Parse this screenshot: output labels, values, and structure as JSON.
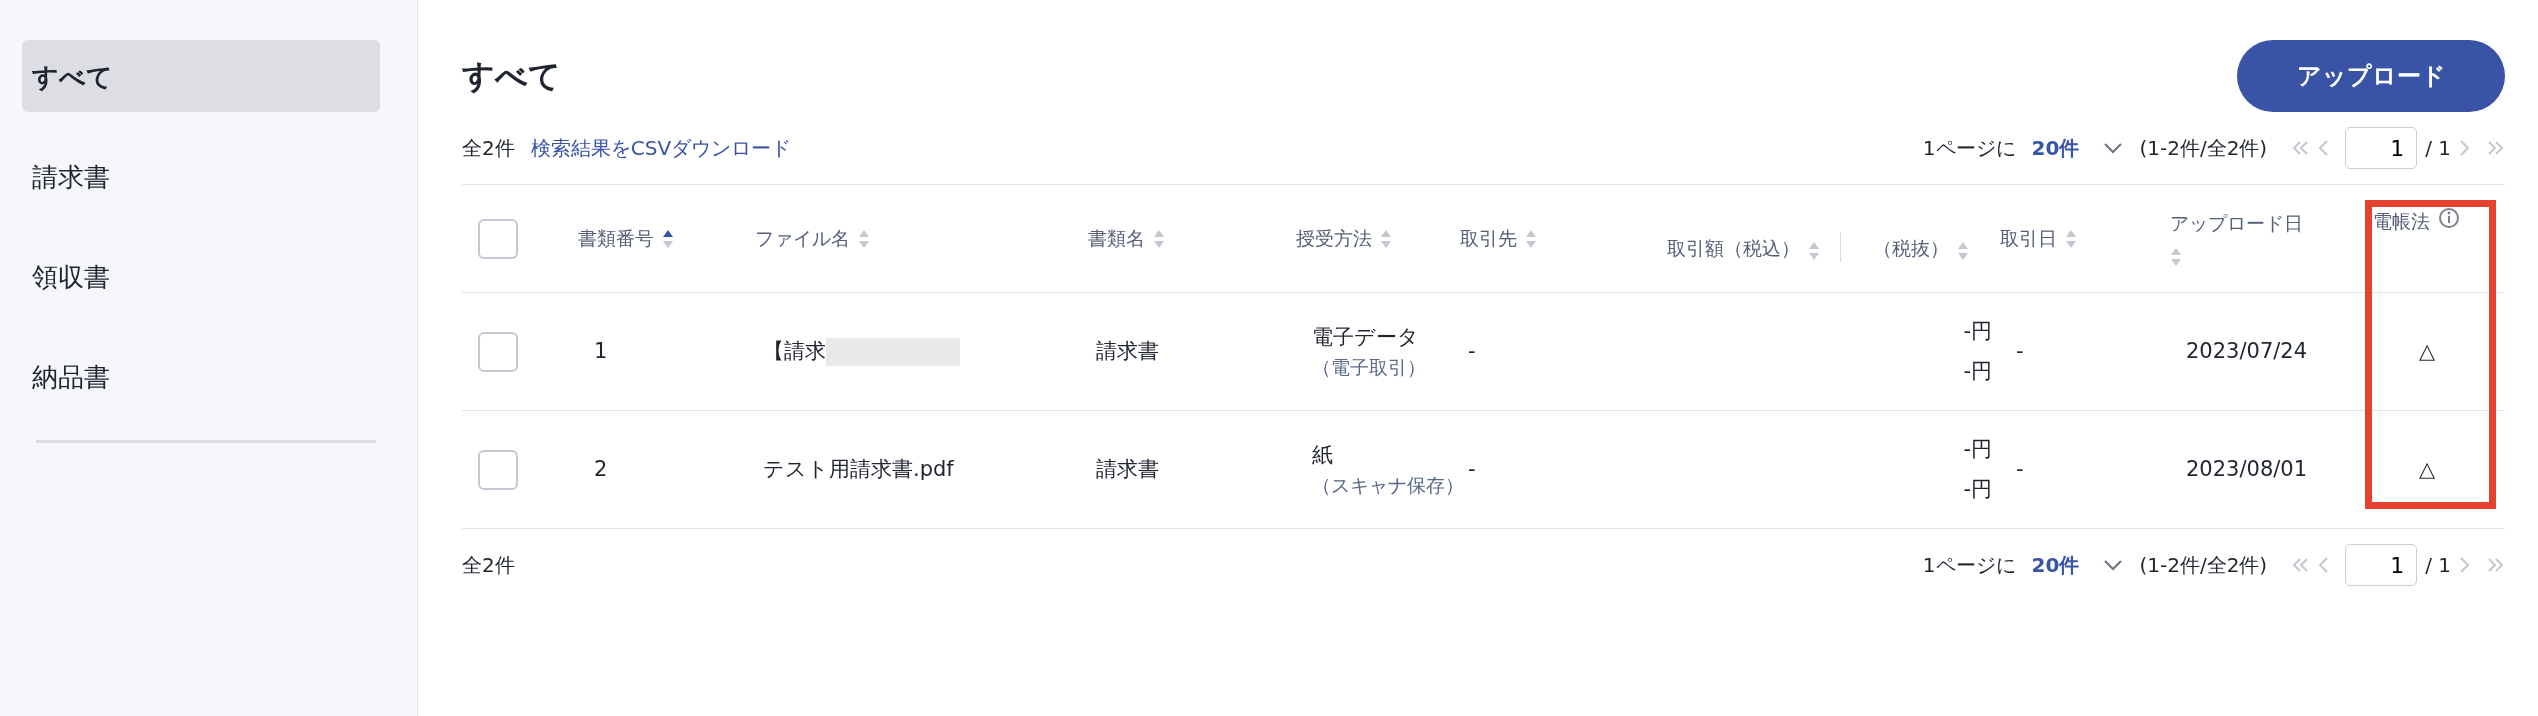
{
  "sidebar": {
    "items": [
      {
        "label": "すべて",
        "selected": true
      },
      {
        "label": "請求書",
        "selected": false
      },
      {
        "label": "領収書",
        "selected": false
      },
      {
        "label": "納品書",
        "selected": false
      }
    ]
  },
  "page": {
    "title": "すべて",
    "upload_button": "アップロード",
    "total": "全2件",
    "csv_link": "検索結果をCSVダウンロード"
  },
  "pagination_top": {
    "per_page_label": "1ページに",
    "per_page": "20件",
    "range": "(1-2件/全2件)",
    "page": "1",
    "pages": "/ 1",
    "disabled": true
  },
  "table": {
    "select_all_checked": false,
    "columns": [
      {
        "label": "書類番号",
        "sortable": true,
        "sorted": true
      },
      {
        "label": "ファイル名",
        "sortable": true,
        "sorted": false
      },
      {
        "label": "書類名",
        "sortable": true,
        "sorted": false
      },
      {
        "label": "授受方法",
        "sortable": true,
        "sorted": false
      },
      {
        "label": "取引先",
        "sortable": true,
        "sorted": false
      },
      {
        "label": "取引額（税込）",
        "sortable": true,
        "sorted": false
      },
      {
        "label": "（税抜）",
        "sortable": true,
        "sorted": false
      },
      {
        "label": "取引日",
        "sortable": true,
        "sorted": false
      },
      {
        "label": "アップロード日",
        "sortable": true,
        "sorted": false
      },
      {
        "label": "電帳法",
        "sortable": false,
        "info": true,
        "highlighted": true
      }
    ],
    "rows": [
      {
        "checked": false,
        "number": "1",
        "file_name": "【請求",
        "redacted": true,
        "doc_name": "請求書",
        "method": "電子データ",
        "method_detail": "（電子取引）",
        "partner": "-",
        "amount_incl": "-円",
        "amount_excl": "-円",
        "deal_date": "-",
        "upload_date": "2023/07/24",
        "dencho": "△"
      },
      {
        "checked": false,
        "number": "2",
        "file_name": "テスト用請求書.pdf",
        "redacted": false,
        "doc_name": "請求書",
        "method": "紙",
        "method_detail": "（スキャナ保存）",
        "partner": "-",
        "amount_incl": "-円",
        "amount_excl": "-円",
        "deal_date": "-",
        "upload_date": "2023/08/01",
        "dencho": "△"
      }
    ]
  },
  "footer": {
    "total": "全2件"
  },
  "pagination_bottom": {
    "per_page_label": "1ページに",
    "per_page": "20件",
    "range": "(1-2件/全2件)",
    "page": "1",
    "pages": "/ 1",
    "disabled": true
  }
}
